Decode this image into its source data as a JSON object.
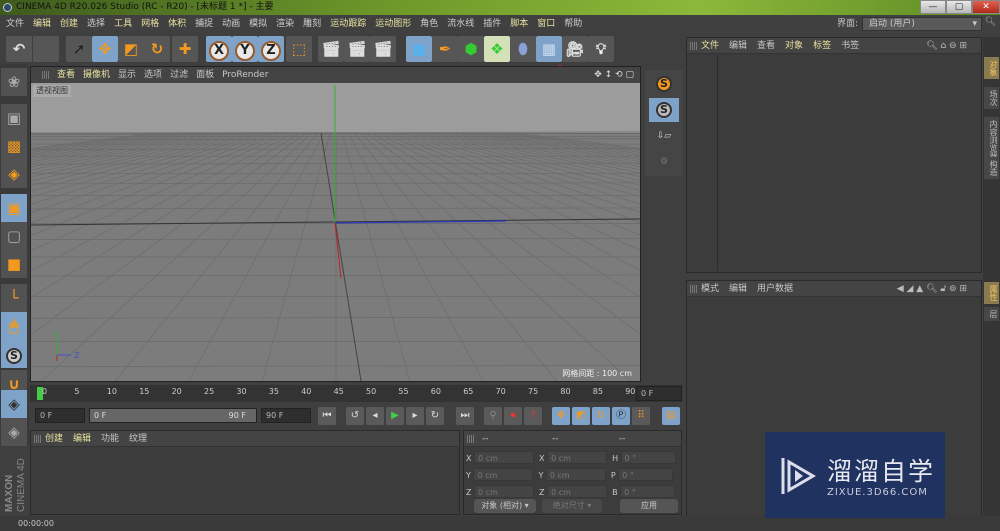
{
  "window": {
    "title": "CINEMA 4D R20.026 Studio (RC - R20) - [未标题 1 *] - 主要",
    "minimize": "—",
    "maximize": "▢",
    "close": "✕"
  },
  "menu": [
    {
      "label": "文件",
      "hl": false
    },
    {
      "label": "编辑",
      "hl": true
    },
    {
      "label": "创建",
      "hl": true
    },
    {
      "label": "选择",
      "hl": false
    },
    {
      "label": "工具",
      "hl": true
    },
    {
      "label": "网格",
      "hl": true
    },
    {
      "label": "体积",
      "hl": true
    },
    {
      "label": "捕捉",
      "hl": false
    },
    {
      "label": "动画",
      "hl": false
    },
    {
      "label": "模拟",
      "hl": false
    },
    {
      "label": "渲染",
      "hl": false
    },
    {
      "label": "雕刻",
      "hl": false
    },
    {
      "label": "运动跟踪",
      "hl": true
    },
    {
      "label": "运动图形",
      "hl": true
    },
    {
      "label": "角色",
      "hl": false
    },
    {
      "label": "流水线",
      "hl": false
    },
    {
      "label": "插件",
      "hl": false
    },
    {
      "label": "脚本",
      "hl": true
    },
    {
      "label": "窗口",
      "hl": true
    },
    {
      "label": "帮助",
      "hl": false
    }
  ],
  "layout": {
    "label": "界面:",
    "value": "启动 (用户)"
  },
  "toolbar": {
    "axis_x": "X",
    "axis_y": "Y",
    "axis_z": "Z"
  },
  "viewport": {
    "menu": [
      {
        "label": "查看",
        "hl": true
      },
      {
        "label": "摄像机",
        "hl": true
      },
      {
        "label": "显示",
        "hl": false
      },
      {
        "label": "选项",
        "hl": false
      },
      {
        "label": "过滤",
        "hl": false
      },
      {
        "label": "面板",
        "hl": false
      },
      {
        "label": "ProRender",
        "hl": false
      }
    ],
    "view_name": "透视视图",
    "grid_info": "网格间距 : 100 cm",
    "axis_labels": {
      "y": "Y",
      "z": "Z"
    }
  },
  "object_manager": {
    "menu": [
      {
        "label": "文件",
        "hl": true
      },
      {
        "label": "编辑",
        "hl": false
      },
      {
        "label": "查看",
        "hl": false
      },
      {
        "label": "对象",
        "hl": true
      },
      {
        "label": "标签",
        "hl": true
      },
      {
        "label": "书签",
        "hl": false
      }
    ]
  },
  "attribute_manager": {
    "menu": [
      {
        "label": "模式",
        "hl": false
      },
      {
        "label": "编辑",
        "hl": false
      },
      {
        "label": "用户数据",
        "hl": false
      }
    ]
  },
  "right_tabs": {
    "top": [
      {
        "label": "对象",
        "active": true
      },
      {
        "label": "场次",
        "active": false
      },
      {
        "label": "内容浏览器",
        "active": false
      },
      {
        "label": "构造",
        "active": false
      }
    ],
    "bottom": [
      {
        "label": "属性",
        "active": true
      },
      {
        "label": "层",
        "active": false
      }
    ]
  },
  "timeline": {
    "ticks": [
      "0",
      "5",
      "10",
      "15",
      "20",
      "25",
      "30",
      "35",
      "40",
      "45",
      "50",
      "55",
      "60",
      "65",
      "70",
      "75",
      "80",
      "85",
      "90"
    ],
    "current_frame": "0 F",
    "current_frame_pct": 0
  },
  "playback": {
    "start": "0 F",
    "range_start": "0 F",
    "range_end": "90 F",
    "end": "90 F"
  },
  "material_manager": {
    "menu": [
      {
        "label": "创建",
        "hl": true
      },
      {
        "label": "编辑",
        "hl": true
      },
      {
        "label": "功能",
        "hl": false
      },
      {
        "label": "纹理",
        "hl": false
      }
    ]
  },
  "coordinates": {
    "headers": [
      "--",
      "--",
      "--"
    ],
    "rows": [
      {
        "a": "X",
        "av": "0 cm",
        "b": "X",
        "bv": "0 cm",
        "c": "H",
        "cv": "0 °"
      },
      {
        "a": "Y",
        "av": "0 cm",
        "b": "Y",
        "bv": "0 cm",
        "c": "P",
        "cv": "0 °"
      },
      {
        "a": "Z",
        "av": "0 cm",
        "b": "Z",
        "bv": "0 cm",
        "c": "B",
        "cv": "0 °"
      }
    ],
    "mode": "对象 (相对)",
    "size_mode": "绝对尺寸",
    "apply": "应用"
  },
  "status": {
    "time": "00:00:00"
  },
  "brand": {
    "line1": "MAXON",
    "line2": "CINEMA 4D"
  },
  "watermark": {
    "title": "溜溜自学",
    "url": "ZIXUE.3D66.COM"
  },
  "colors": {
    "accent": "#f39a1e",
    "active_tool": "#7fa2c8",
    "highlight_text": "#e8e2a0",
    "annotation_arrow": "#e0201c"
  }
}
